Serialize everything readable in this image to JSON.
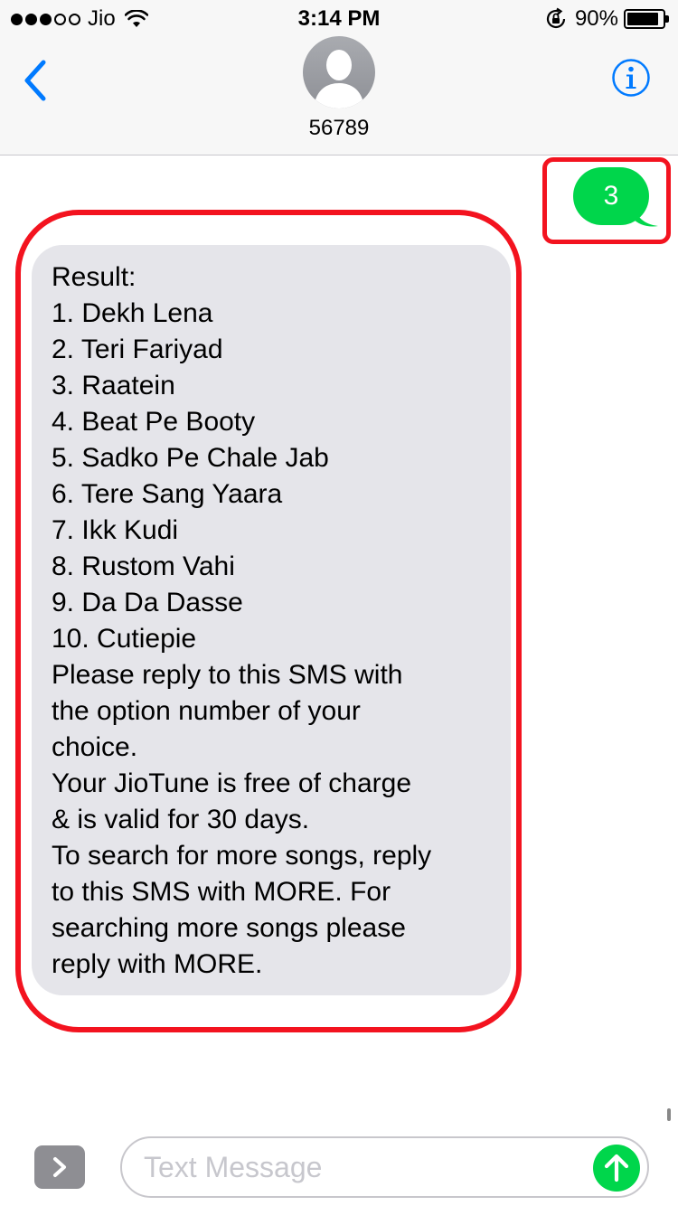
{
  "status_bar": {
    "carrier": "Jio",
    "time": "3:14 PM",
    "battery": "90%",
    "battery_level": 0.9,
    "signal_bars_filled": 3,
    "signal_bars_total": 5
  },
  "header": {
    "contact": "56789",
    "back_icon": "chevron-left-icon",
    "info_icon": "info-icon"
  },
  "conversation": {
    "sent_message": "3",
    "received_lines": [
      "Result:",
      "1. Dekh Lena",
      "2. Teri Fariyad",
      "3. Raatein",
      "4. Beat Pe Booty",
      "5. Sadko Pe Chale Jab",
      "6. Tere Sang Yaara",
      "7. Ikk Kudi",
      "8. Rustom Vahi",
      "9. Da Da Dasse",
      "10. Cutiepie",
      "Please reply to this SMS with",
      "the option number of your",
      "choice.",
      "Your JioTune is free of charge",
      "& is valid for 30 days.",
      "To search for more songs, reply",
      "to this SMS with MORE. For",
      "searching more songs please",
      "reply with MORE."
    ]
  },
  "compose": {
    "placeholder": "Text Message",
    "value": ""
  },
  "colors": {
    "sent_bubble": "#00d64b",
    "received_bubble": "#e5e5ea",
    "accent": "#007aff",
    "highlight": "#f3131f"
  }
}
